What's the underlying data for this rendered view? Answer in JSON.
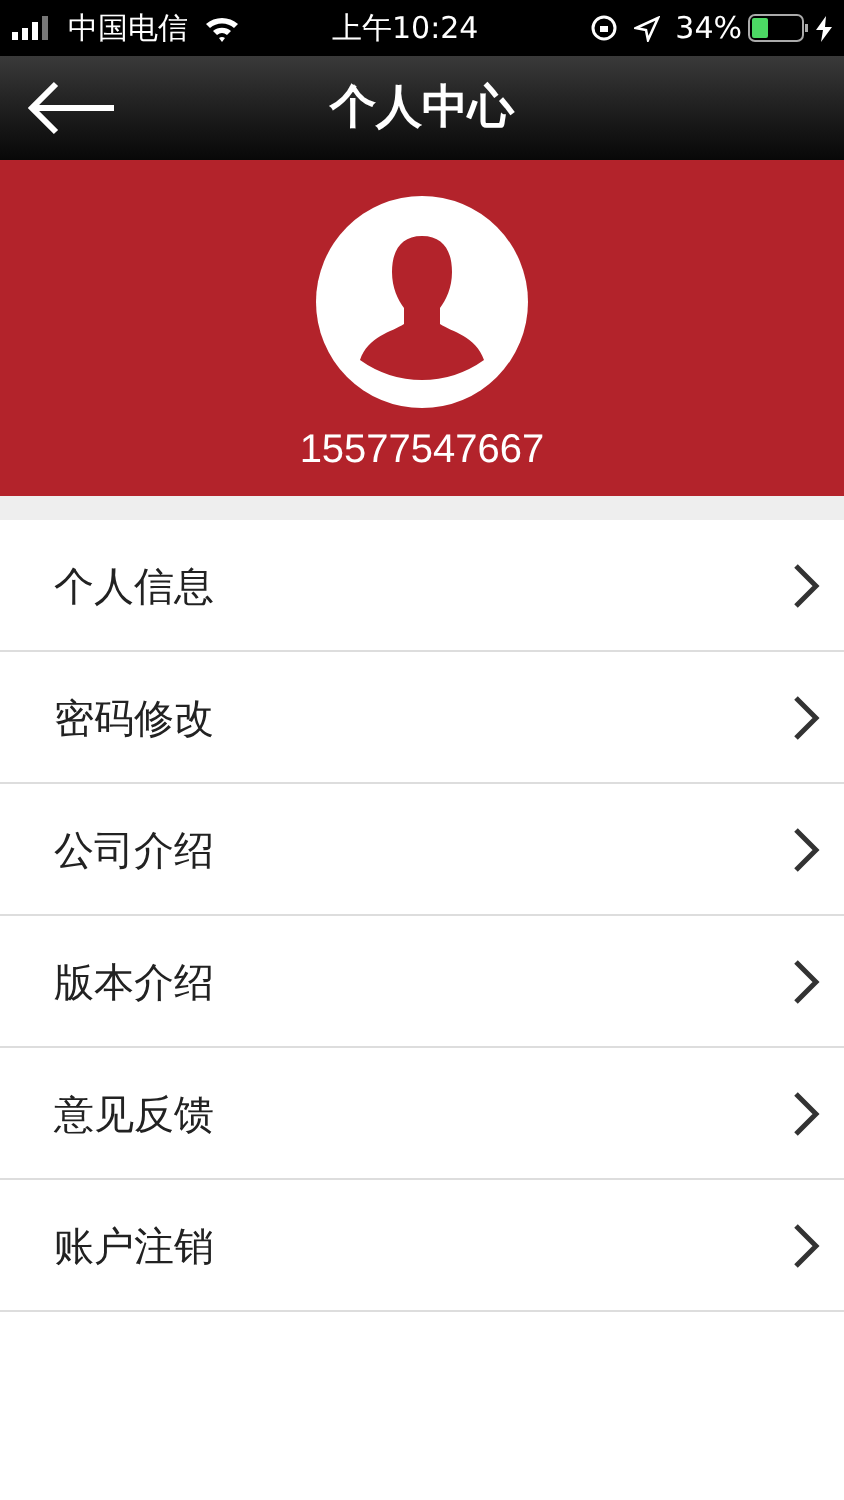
{
  "status_bar": {
    "carrier": "中国电信",
    "time": "上午10:24",
    "battery": "34%"
  },
  "header": {
    "title": "个人中心"
  },
  "profile": {
    "phone": "15577547667"
  },
  "menu": [
    {
      "label": "个人信息"
    },
    {
      "label": "密码修改"
    },
    {
      "label": "公司介绍"
    },
    {
      "label": "版本介绍"
    },
    {
      "label": "意见反馈"
    },
    {
      "label": "账户注销"
    }
  ]
}
